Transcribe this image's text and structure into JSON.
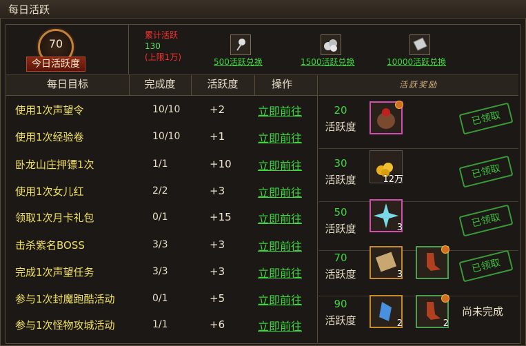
{
  "window": {
    "title": "每日活跃"
  },
  "badge": {
    "value": "70",
    "label": "今日活跃度"
  },
  "accumulated": {
    "line1": "累计活跃",
    "line2": "130",
    "line3": "(上限1万)"
  },
  "exchanges": [
    {
      "icon": "silver-fan-icon",
      "label": "500活跃兑换"
    },
    {
      "icon": "silver-coins-icon",
      "label": "1500活跃兑换"
    },
    {
      "icon": "scroll-map-icon",
      "label": "10000活跃兑换"
    }
  ],
  "table": {
    "headers": [
      "每日目标",
      "完成度",
      "活跃度",
      "操作"
    ],
    "rows": [
      {
        "name": "使用1次声望令",
        "progress": "10/10",
        "points": "+2",
        "action": "立即前往"
      },
      {
        "name": "使用1次经验卷",
        "progress": "10/10",
        "points": "+1",
        "action": "立即前往"
      },
      {
        "name": "卧龙山庄押镖1次",
        "progress": "1/1",
        "points": "+10",
        "action": "立即前往"
      },
      {
        "name": "使用1次女儿红",
        "progress": "2/2",
        "points": "+3",
        "action": "立即前往"
      },
      {
        "name": "领取1次月卡礼包",
        "progress": "0/1",
        "points": "+15",
        "action": "立即前往"
      },
      {
        "name": "击杀紫名BOSS",
        "progress": "3/3",
        "points": "+3",
        "action": "立即前往"
      },
      {
        "name": "完成1次声望任务",
        "progress": "3/3",
        "points": "+3",
        "action": "立即前往"
      },
      {
        "name": "参与1次封魔跑酷活动",
        "progress": "0/1",
        "points": "+5",
        "action": "立即前往"
      },
      {
        "name": "参与1次怪物攻城活动",
        "progress": "1/1",
        "points": "+6",
        "action": "立即前往"
      }
    ]
  },
  "rewards": {
    "header": "活跃奖励",
    "unit": "活跃度",
    "claimed_label": "已领取",
    "pending_label": "尚未完成",
    "tiers": [
      {
        "points": "20",
        "items": [
          {
            "icon": "red-pouch-icon",
            "count": ""
          }
        ],
        "status": "claimed"
      },
      {
        "points": "30",
        "items": [
          {
            "icon": "gold-coins-icon",
            "count": "12万"
          }
        ],
        "status": "claimed"
      },
      {
        "points": "50",
        "items": [
          {
            "icon": "blue-star-gem-icon",
            "count": "3"
          }
        ],
        "status": "claimed"
      },
      {
        "points": "70",
        "items": [
          {
            "icon": "scroll-icon",
            "count": "3"
          },
          {
            "icon": "red-boot-icon",
            "count": ""
          }
        ],
        "status": "claimed"
      },
      {
        "points": "90",
        "items": [
          {
            "icon": "blue-crystal-icon",
            "count": "2"
          },
          {
            "icon": "red-boot-icon",
            "count": "2"
          }
        ],
        "status": "pending"
      }
    ]
  }
}
